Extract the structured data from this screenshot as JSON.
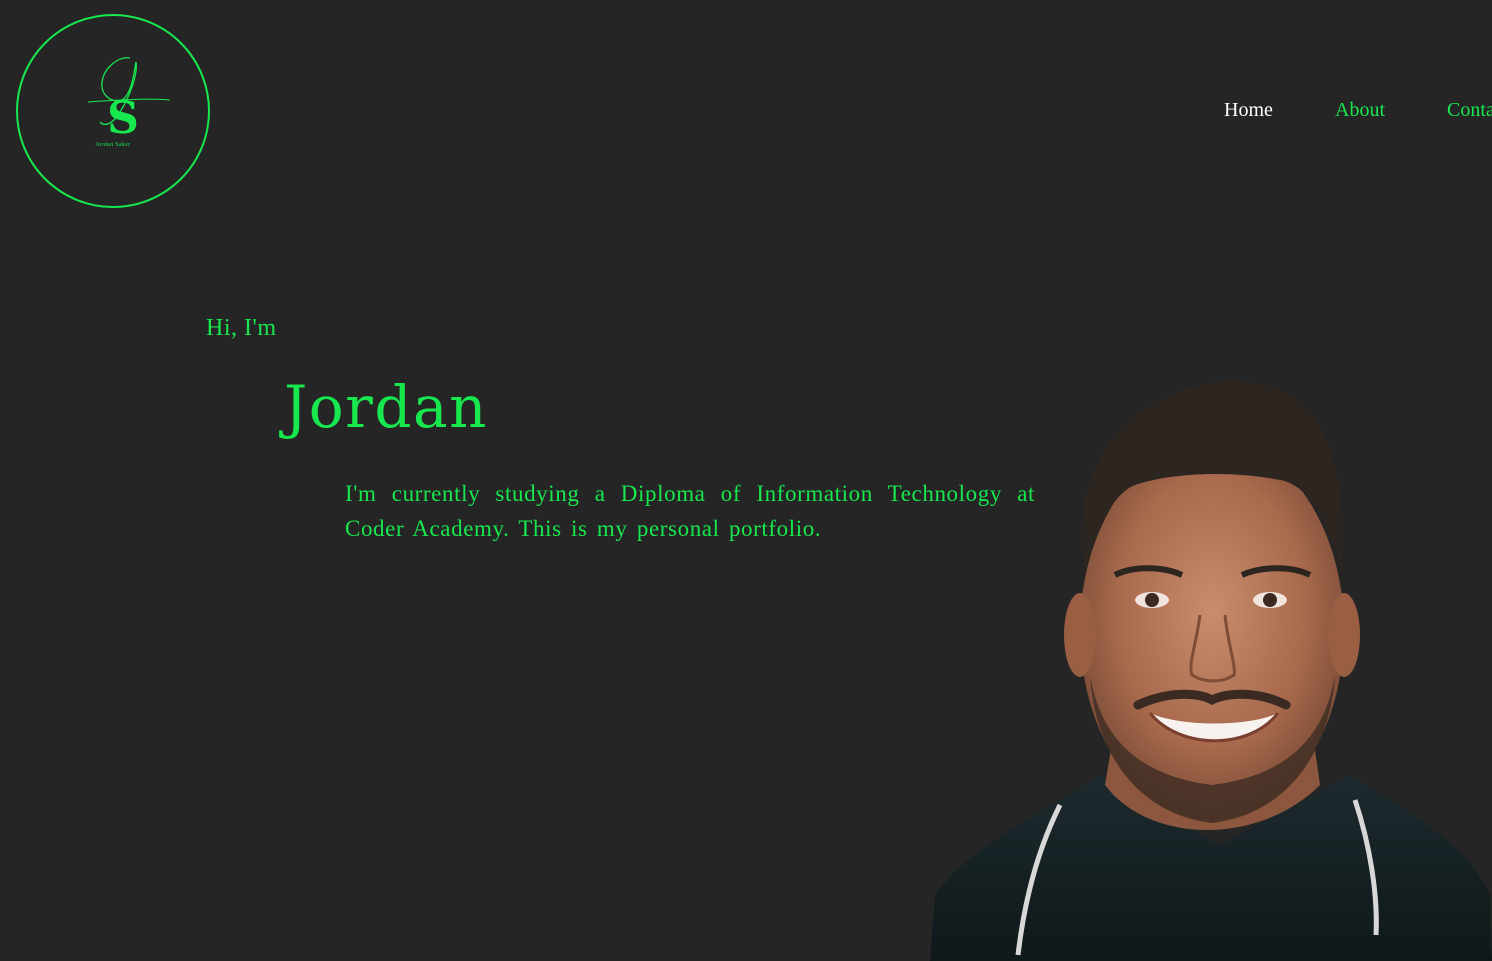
{
  "header": {
    "logo": {
      "monogram_letters": "JS",
      "caption": "Jordan Saker",
      "accent_color": "#17e84e"
    },
    "nav": [
      {
        "label": "Home",
        "active": true
      },
      {
        "label": "About",
        "active": false
      },
      {
        "label": "Conta",
        "active": false
      }
    ]
  },
  "hero": {
    "greeting": "Hi, I'm",
    "name": "Jordan",
    "description": "I'm currently studying a Diploma of Information Technology at Coder Academy. This is my personal portfolio."
  },
  "colors": {
    "background": "#252525",
    "accent": "#17e84e",
    "nav_active": "#ffffff"
  }
}
